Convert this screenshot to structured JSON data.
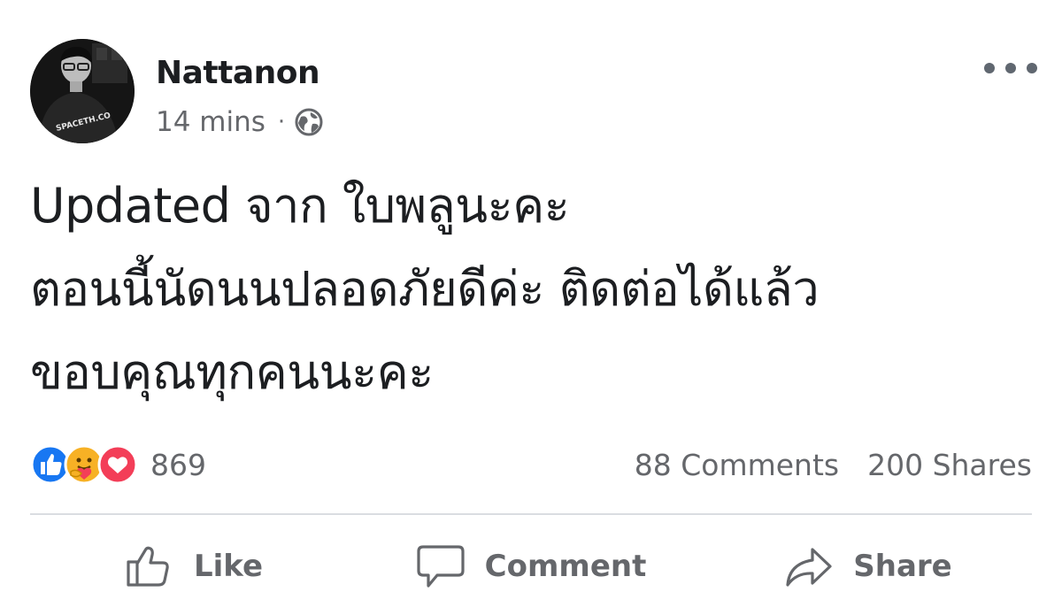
{
  "post": {
    "author": {
      "name": "Nattanon",
      "avatar_shirt_text": "SPACETH.CO"
    },
    "time": "14 mins",
    "separator": "·",
    "audience_icon": "globe-icon",
    "more_icon": "ellipsis-icon",
    "text": "Updated จาก ใบพลูนะคะ\nตอนนี้นัดนนปลอดภัยดีค่ะ ติดต่อได้แล้ว\nขอบคุณทุกคนนะคะ",
    "reactions": {
      "icons": [
        "like-icon",
        "care-icon",
        "love-icon"
      ],
      "count": "869"
    },
    "stats": {
      "comments": "88 Comments",
      "shares": "200 Shares"
    },
    "actions": {
      "like": "Like",
      "comment": "Comment",
      "share": "Share"
    },
    "colors": {
      "like_blue": "#1877f2",
      "love_red": "#f33e58",
      "care_yellow": "#f7b125",
      "text": "#1c1e21",
      "secondary": "#65676b"
    }
  }
}
